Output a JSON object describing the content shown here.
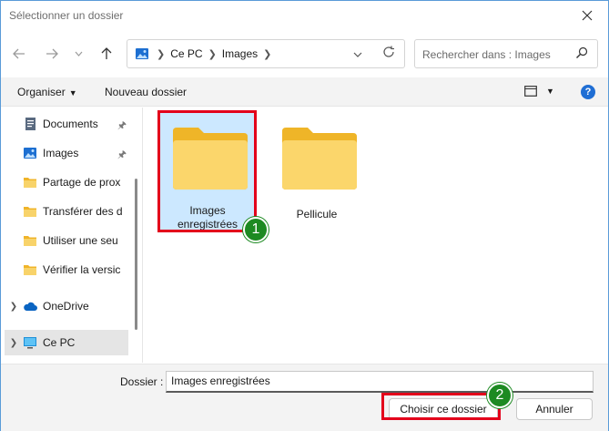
{
  "window": {
    "title": "Sélectionner un dossier"
  },
  "navbar": {
    "breadcrumb": [
      "Ce PC",
      "Images"
    ],
    "search_placeholder": "Rechercher dans : Images"
  },
  "toolbar": {
    "organize_label": "Organiser",
    "new_folder_label": "Nouveau dossier",
    "help_label": "?"
  },
  "sidebar": {
    "items": [
      {
        "label": "Documents",
        "icon": "documents-icon",
        "pinned": true
      },
      {
        "label": "Images",
        "icon": "images-icon",
        "pinned": true
      },
      {
        "label": "Partage de prox",
        "icon": "folder-icon"
      },
      {
        "label": "Transférer des d",
        "icon": "folder-icon"
      },
      {
        "label": "Utiliser une seu",
        "icon": "folder-icon"
      },
      {
        "label": "Vérifier la versic",
        "icon": "folder-icon"
      },
      {
        "label": "OneDrive",
        "icon": "onedrive-icon"
      },
      {
        "label": "Ce PC",
        "icon": "computer-icon",
        "selected": true
      }
    ]
  },
  "content": {
    "folders": [
      {
        "label": "Images enregistrées",
        "selected": true
      },
      {
        "label": "Pellicule"
      }
    ]
  },
  "bottom": {
    "folder_label": "Dossier :",
    "folder_value": "Images enregistrées",
    "choose_label": "Choisir ce dossier",
    "cancel_label": "Annuler"
  },
  "annotations": {
    "step1": "1",
    "step2": "2"
  },
  "colors": {
    "highlight": "#e3001b",
    "badge": "#1d8a22",
    "accent": "#1f6ed4",
    "folder": "#f8c94a"
  }
}
